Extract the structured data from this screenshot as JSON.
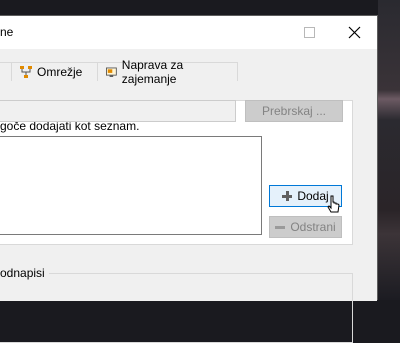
{
  "window": {
    "title": "ne"
  },
  "tabs": [
    {
      "label": "",
      "icon": "tab-icon"
    },
    {
      "label": "Omrežje",
      "icon": "network-icon"
    },
    {
      "label": "Naprava za zajemanje",
      "icon": "capture-device-icon"
    }
  ],
  "panel": {
    "description": "goče dodajati kot seznam.",
    "add_label": "Dodaj",
    "remove_label": "Odstrani"
  },
  "subtitles": {
    "group_label": "odnapisi",
    "file_value": "",
    "browse_label": "Prebrskaj ..."
  },
  "colors": {
    "accent": "#0078d7",
    "hover_bg": "#e5f1fb",
    "disabled_bg": "#cccccc",
    "disabled_text": "#838383"
  }
}
